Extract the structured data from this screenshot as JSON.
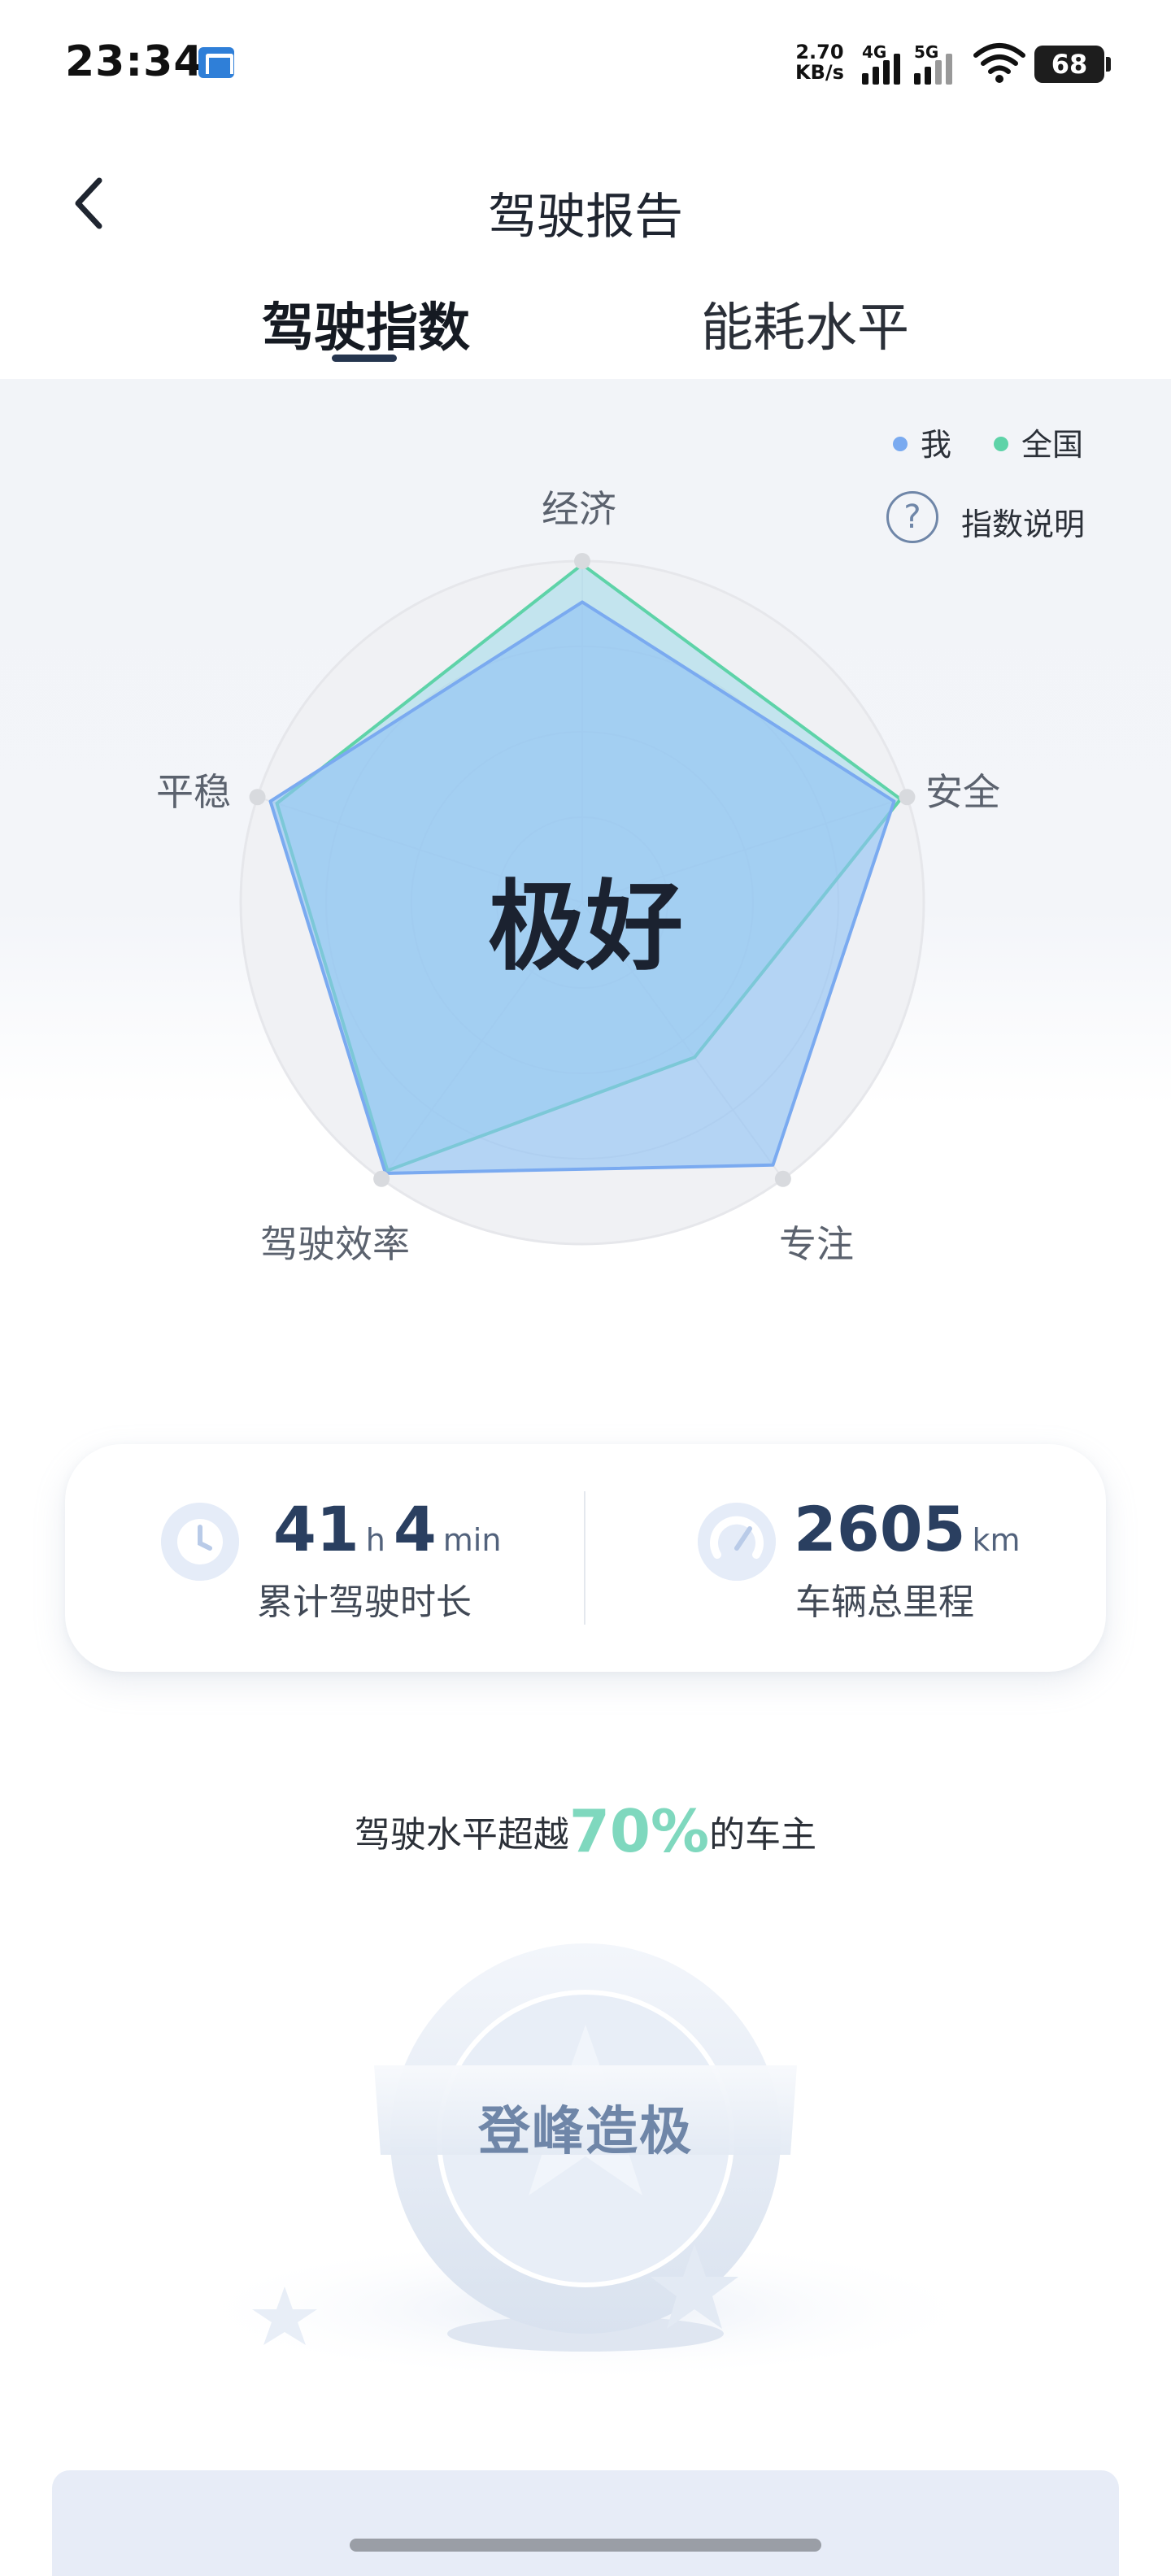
{
  "status_bar": {
    "time": "23:34",
    "net_speed_value": "2.70",
    "net_speed_unit": "KB/s",
    "net1": "4G",
    "net2": "5G",
    "battery": "68"
  },
  "header": {
    "title": "驾驶报告",
    "back_icon": "chevron-left-icon"
  },
  "tabs": [
    {
      "label": "驾驶指数",
      "active": true
    },
    {
      "label": "能耗水平",
      "active": false
    }
  ],
  "legend": {
    "me": "我",
    "national": "全国"
  },
  "info_button": "指数说明",
  "radar": {
    "rating": "极好",
    "axes": [
      "经济",
      "安全",
      "专注",
      "驾驶效率",
      "平稳"
    ],
    "series": [
      {
        "name": "我",
        "color": "#7aaaf0",
        "values": [
          0.88,
          0.96,
          0.95,
          0.98,
          0.96
        ]
      },
      {
        "name": "全国",
        "color": "#5ed3a8",
        "values": [
          0.99,
          0.98,
          0.56,
          0.97,
          0.94
        ]
      }
    ],
    "max": 1.0
  },
  "stats": {
    "drive_hours": "41",
    "hours_unit": "h",
    "drive_minutes": "4",
    "minutes_unit": "min",
    "drive_time_label": "累计驾驶时长",
    "mileage": "2605",
    "mileage_unit": "km",
    "mileage_label": "车辆总里程"
  },
  "ranking": {
    "prefix": "驾驶水平超越",
    "percent": "70%",
    "suffix": "的车主"
  },
  "badge": {
    "title": "登峰造极"
  },
  "colors": {
    "me": "#7aaaf0",
    "national": "#5ed3a8",
    "accent_percent": "#7fd8be"
  }
}
